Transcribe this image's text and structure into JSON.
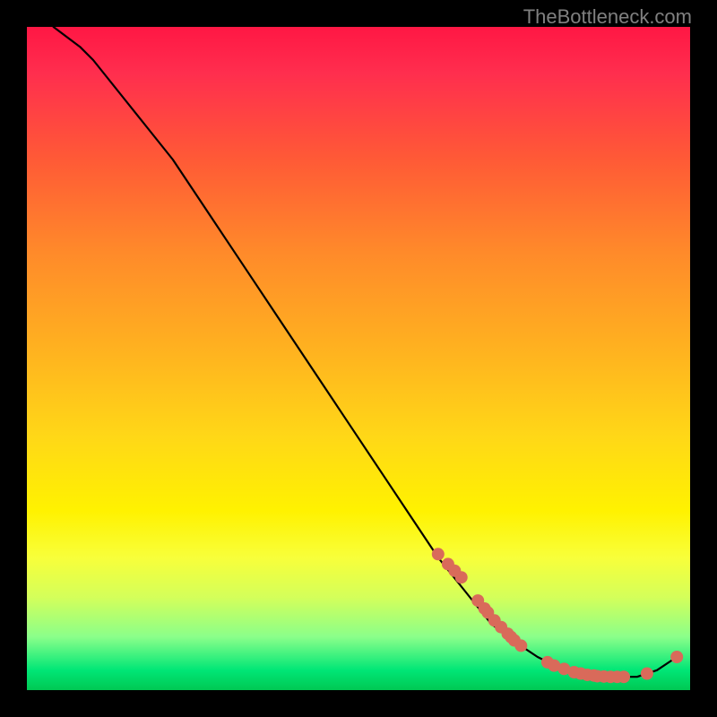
{
  "attribution": "TheBottleneck.com",
  "chart_data": {
    "type": "line",
    "title": "",
    "xlabel": "",
    "ylabel": "",
    "xlim": [
      0,
      100
    ],
    "ylim": [
      0,
      100
    ],
    "series": [
      {
        "name": "curve",
        "x": [
          4,
          6,
          8,
          10,
          12,
          14,
          18,
          22,
          26,
          30,
          34,
          38,
          42,
          46,
          50,
          54,
          58,
          62,
          66,
          70,
          74,
          77,
          80,
          83,
          86,
          89,
          92,
          95,
          98
        ],
        "y": [
          100,
          98.5,
          97,
          95,
          92.5,
          90,
          85,
          80,
          74,
          68,
          62,
          56,
          50,
          44,
          38,
          32,
          26,
          20,
          15,
          10,
          7,
          5,
          3.5,
          2.5,
          2,
          2,
          2,
          3,
          5
        ]
      }
    ],
    "markers": {
      "name": "highlight-points",
      "color": "#d96a5a",
      "x": [
        62,
        63.5,
        64.5,
        65.5,
        68,
        69,
        69.5,
        70.5,
        71.5,
        72.5,
        73,
        73.5,
        74.5,
        78.5,
        79.5,
        81,
        82.5,
        83.5,
        84.5,
        85.5,
        86,
        87,
        88,
        89,
        90,
        93.5,
        98
      ],
      "y": [
        20.5,
        19,
        18,
        17,
        13.5,
        12.3,
        11.7,
        10.5,
        9.5,
        8.5,
        8,
        7.5,
        6.7,
        4.2,
        3.7,
        3.2,
        2.7,
        2.5,
        2.3,
        2.2,
        2.1,
        2.05,
        2.0,
        2.0,
        2.0,
        2.5,
        5.0
      ]
    }
  }
}
